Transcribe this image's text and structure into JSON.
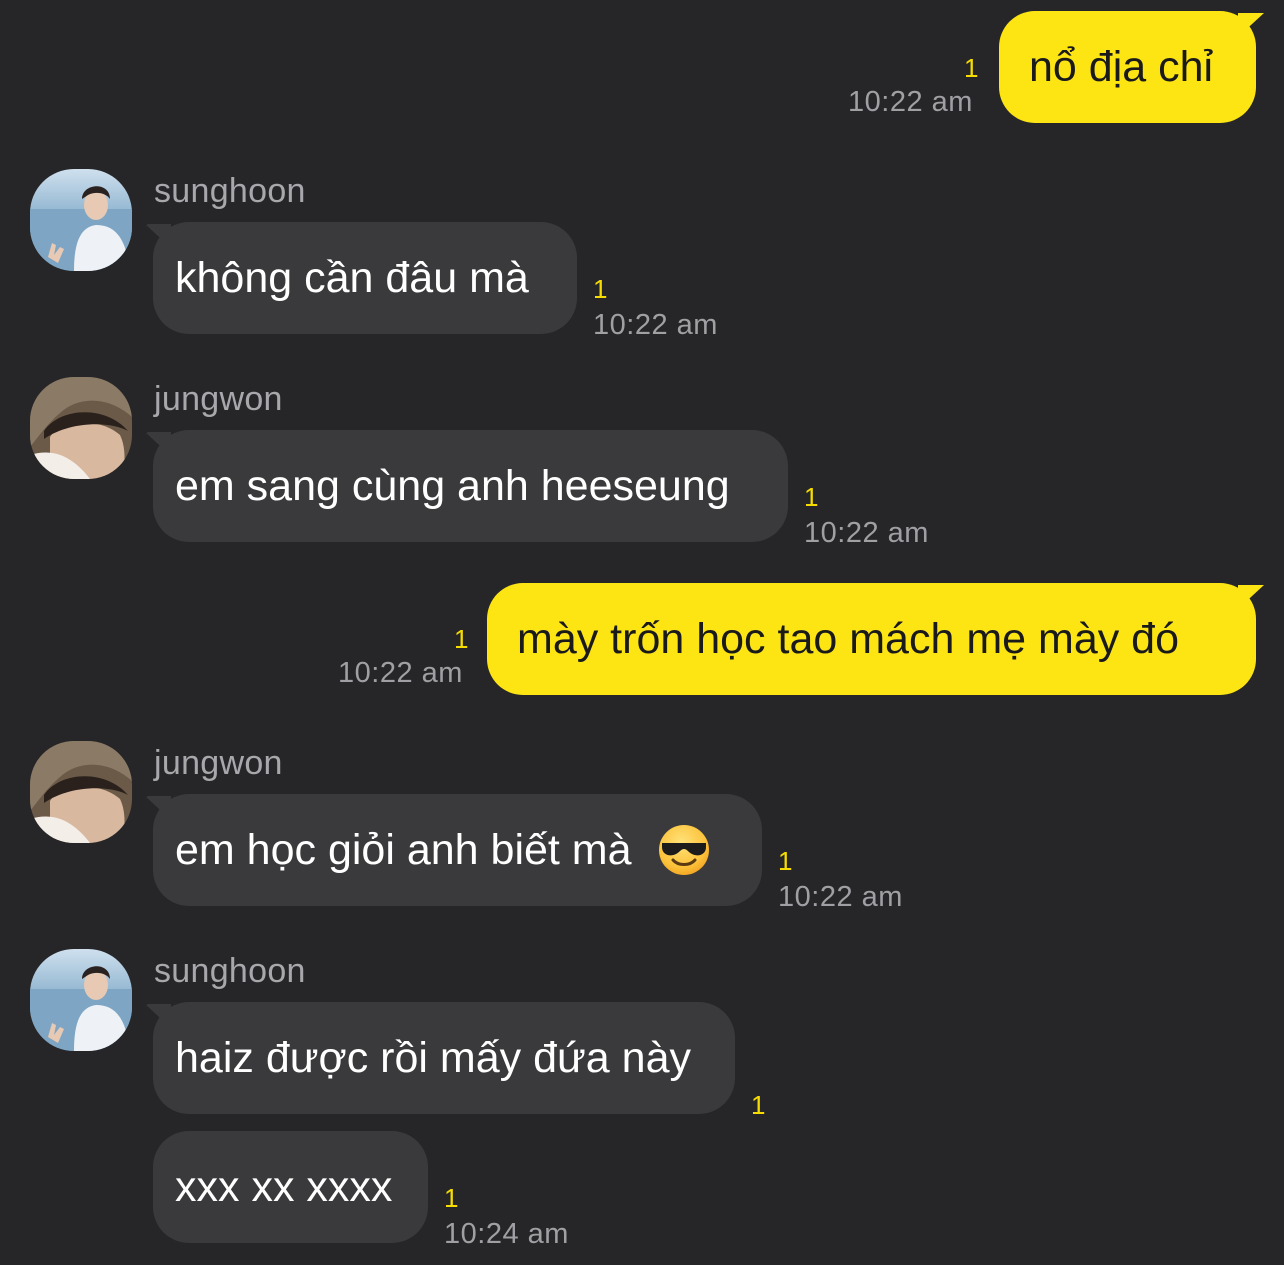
{
  "messages": [
    {
      "sender": "",
      "text": "nổ địa chỉ",
      "unread": "1",
      "time": "10:22 am",
      "outgoing": true
    },
    {
      "sender": "sunghoon",
      "text": "không cần đâu mà",
      "unread": "1",
      "time": "10:22 am"
    },
    {
      "sender": "jungwon",
      "text": "em sang cùng anh heeseung",
      "unread": "1",
      "time": "10:22 am"
    },
    {
      "sender": "",
      "text": "mày trốn học tao mách mẹ mày đó",
      "unread": "1",
      "time": "10:22 am",
      "outgoing": true
    },
    {
      "sender": "jungwon",
      "text": "em học giỏi anh biết mà",
      "emoji": "smiling-face-with-sunglasses",
      "unread": "1",
      "time": "10:22 am"
    },
    {
      "sender": "sunghoon",
      "text": "haiz được rồi mấy đứa này",
      "unread": "1",
      "time": ""
    },
    {
      "sender": "sunghoon",
      "text": "xxx xx xxxx",
      "unread": "1",
      "time": "10:24 am"
    }
  ],
  "colors": {
    "background": "#262628",
    "incoming_bubble": "#3a3a3c",
    "outgoing_bubble": "#fde514",
    "unread_count": "#f6dc00",
    "timestamp": "#a0a0a4",
    "sender_name": "#a8a8ac"
  },
  "avatars": {
    "sunghoon": "avatar-photo-sunghoon",
    "jungwon": "avatar-photo-jungwon"
  }
}
